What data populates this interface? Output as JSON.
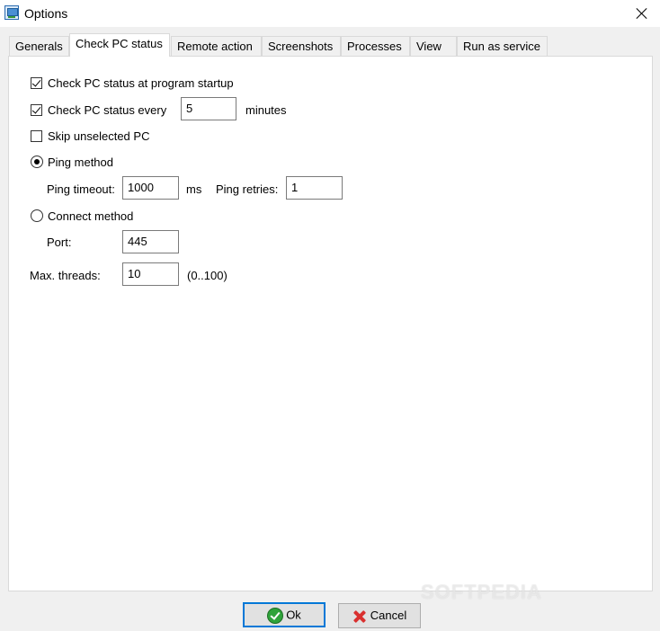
{
  "window": {
    "title": "Options",
    "icon": "app-icon",
    "close_icon": "close-icon"
  },
  "tabs": [
    {
      "label": "Generals",
      "active": false
    },
    {
      "label": "Check PC status",
      "active": true
    },
    {
      "label": "Remote action",
      "active": false
    },
    {
      "label": "Screenshots",
      "active": false
    },
    {
      "label": "Processes",
      "active": false
    },
    {
      "label": "View",
      "active": false
    },
    {
      "label": "Run as service",
      "active": false
    }
  ],
  "check_pc": {
    "startup": {
      "label": "Check PC status at program startup",
      "checked": true
    },
    "every": {
      "label": "Check PC status every",
      "checked": true,
      "value": "5",
      "unit": "minutes"
    },
    "skip": {
      "label": "Skip unselected PC",
      "checked": false
    },
    "ping": {
      "label": "Ping method",
      "selected": true,
      "timeout_label": "Ping timeout:",
      "timeout_value": "1000",
      "timeout_unit": "ms",
      "retries_label": "Ping retries:",
      "retries_value": "1"
    },
    "connect": {
      "label": "Connect method",
      "selected": false,
      "port_label": "Port:",
      "port_value": "445"
    },
    "threads": {
      "label": "Max. threads:",
      "value": "10",
      "range": "(0..100)"
    }
  },
  "buttons": {
    "ok": "Ok",
    "cancel": "Cancel"
  },
  "watermark": "SOFTPEDIA"
}
